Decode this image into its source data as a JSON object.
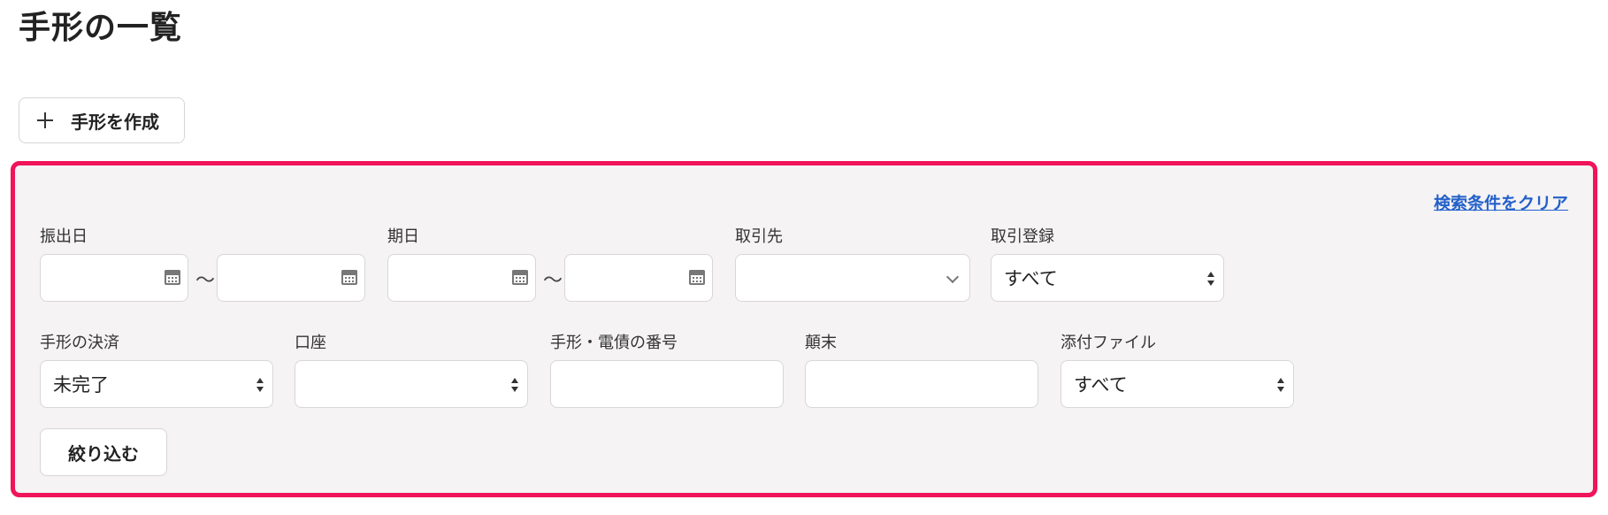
{
  "page": {
    "title": "手形の一覧"
  },
  "toolbar": {
    "create_label": "手形を作成"
  },
  "filters": {
    "clear_label": "検索条件をクリア",
    "range_separator": "〜",
    "issue_date": {
      "label": "振出日",
      "from": "",
      "to": ""
    },
    "due_date": {
      "label": "期日",
      "from": "",
      "to": ""
    },
    "partner": {
      "label": "取引先",
      "value": ""
    },
    "transaction_registration": {
      "label": "取引登録",
      "value": "すべて"
    },
    "settlement": {
      "label": "手形の決済",
      "value": "未完了"
    },
    "account": {
      "label": "口座",
      "value": ""
    },
    "number": {
      "label": "手形・電債の番号",
      "value": ""
    },
    "summary": {
      "label": "顛末",
      "value": ""
    },
    "attachment": {
      "label": "添付ファイル",
      "value": "すべて"
    },
    "apply_label": "絞り込む"
  }
}
